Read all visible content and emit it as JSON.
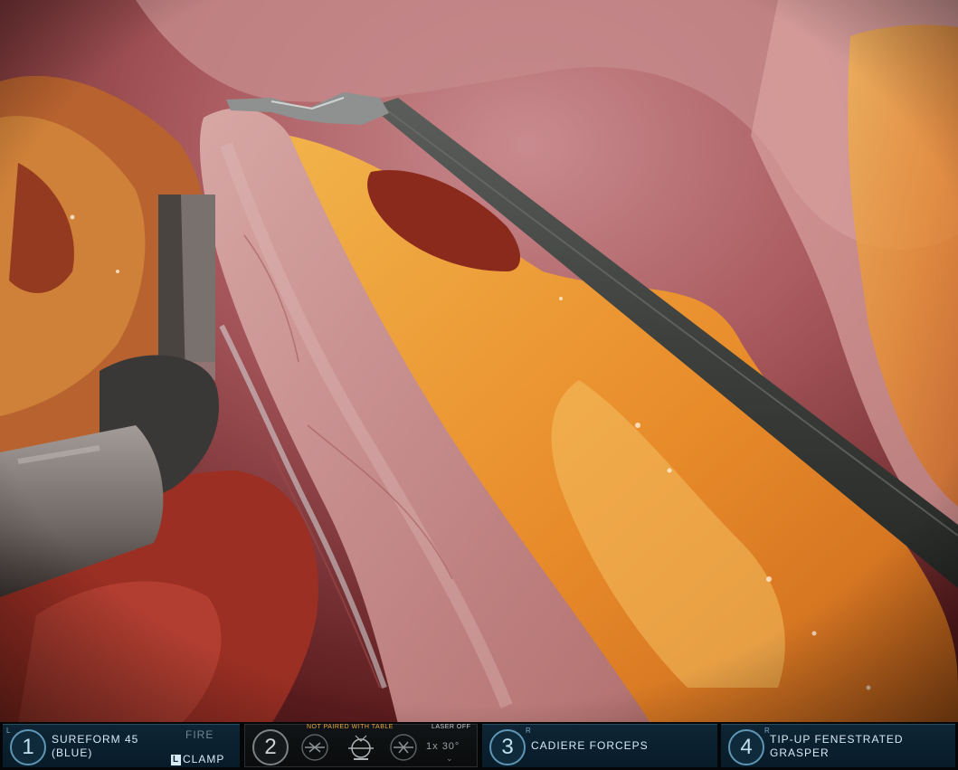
{
  "arms": [
    {
      "number": "1",
      "side": "L",
      "tool": "SUREFORM 45",
      "tool_sub": "(BLUE)",
      "fire_label": "FIRE",
      "clamp_badge": "L",
      "clamp_label": "CLAMP"
    },
    {
      "number": "2",
      "camera_status_left": "NOT PAIRED WITH TABLE",
      "camera_status_right": "LASER OFF",
      "zoom": "1x",
      "angle": "30°"
    },
    {
      "number": "3",
      "side": "R",
      "tool": "CADIERE FORCEPS"
    },
    {
      "number": "4",
      "side": "R",
      "tool": "TIP-UP FENESTRATED",
      "tool_sub": "GRASPER"
    }
  ],
  "icons": {
    "camera_left": "camera-control-left-icon",
    "camera_center": "camera-orientation-icon",
    "camera_right": "camera-control-right-icon"
  },
  "colors": {
    "panel_bg": "#0d2535",
    "panel_border": "#5e96b4",
    "text": "#d6eaf4",
    "warning": "#e8a640"
  }
}
